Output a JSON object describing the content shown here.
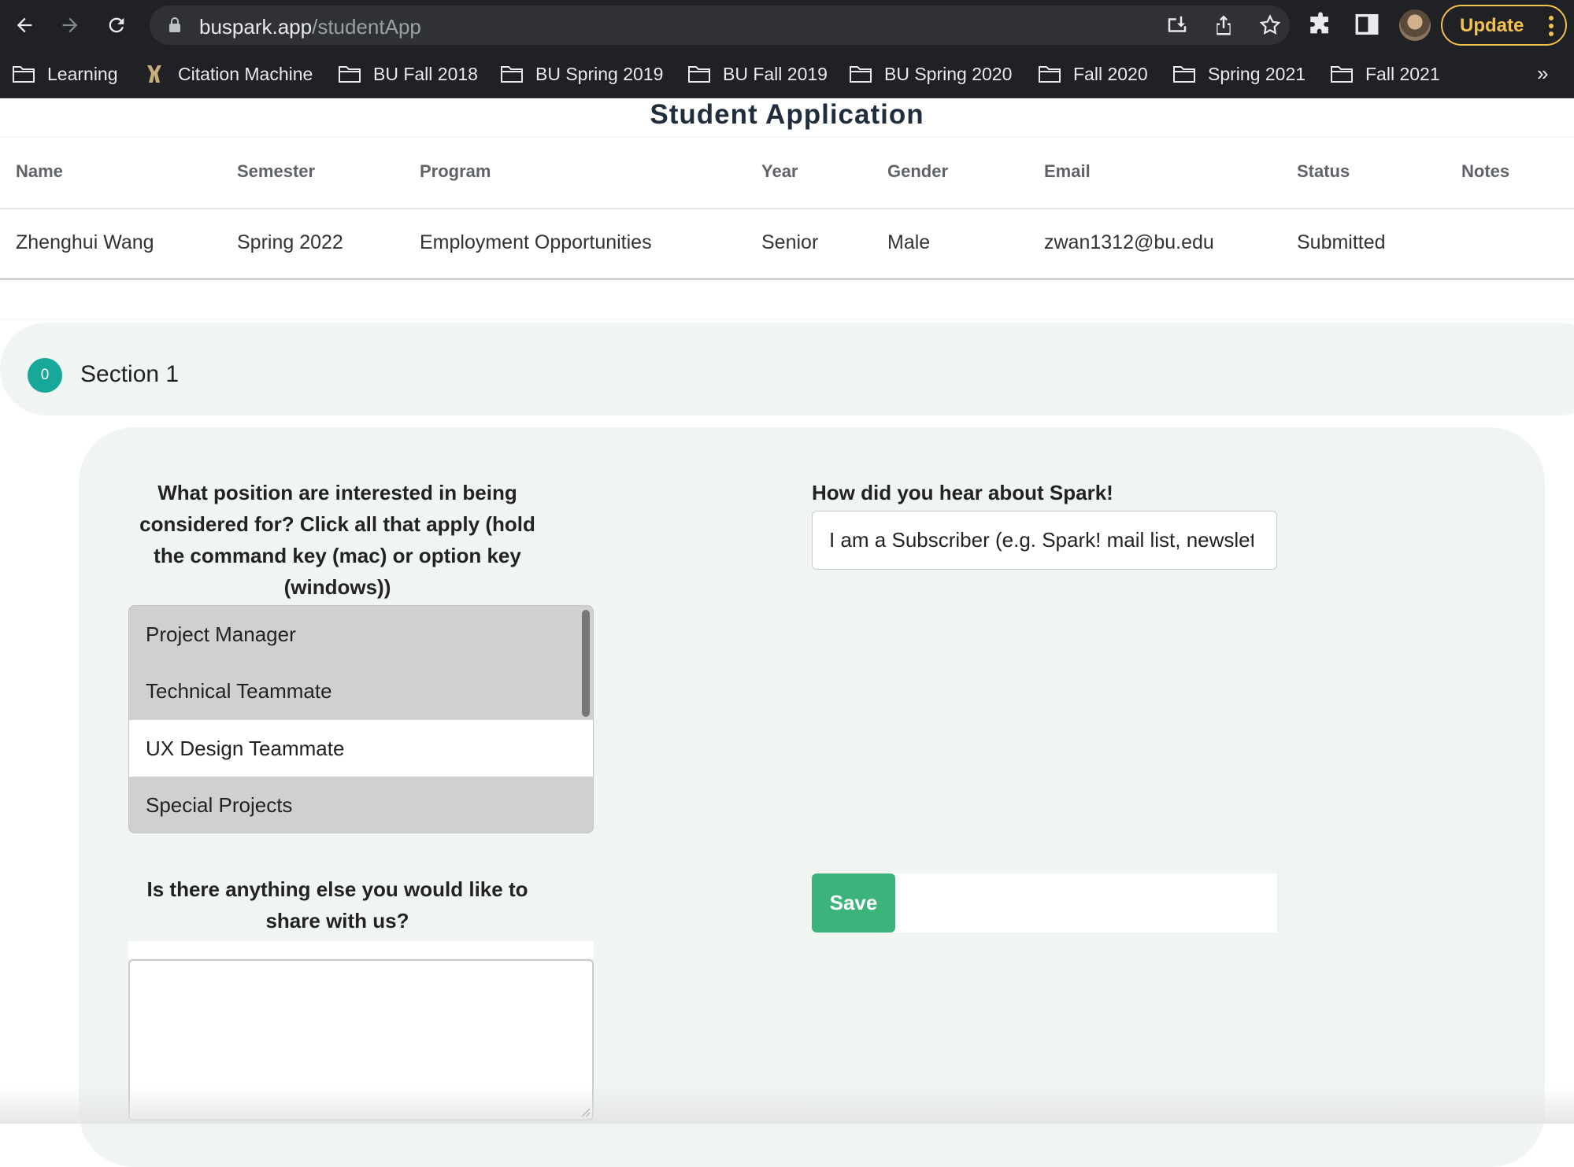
{
  "browser": {
    "url_host": "buspark.app",
    "url_path": "/studentApp",
    "update_label": "Update",
    "bookmarks": [
      "Learning",
      "Citation Machine",
      "BU Fall 2018",
      "BU Spring 2019",
      "BU Fall 2019",
      "BU Spring 2020",
      "Fall 2020",
      "Spring 2021",
      "Fall 2021"
    ],
    "more_label": "»"
  },
  "page": {
    "title": "Student Application"
  },
  "table": {
    "headers": [
      "Name",
      "Semester",
      "Program",
      "Year",
      "Gender",
      "Email",
      "Status",
      "Notes"
    ],
    "row": [
      "Zhenghui Wang",
      "Spring 2022",
      "Employment Opportunities",
      "Senior",
      "Male",
      "zwan1312@bu.edu",
      "Submitted",
      ""
    ]
  },
  "section": {
    "badge": "0",
    "title": "Section 1"
  },
  "form": {
    "position_question": "What position are interested in being considered for? Click all that apply (hold the command key (mac) or option key (windows))",
    "position_options": [
      "Project Manager",
      "Technical Teammate",
      "UX Design Teammate",
      "Special Projects"
    ],
    "hear_question": "How did you hear about Spark!",
    "hear_value": "I am a Subscriber (e.g. Spark! mail list, newsletter)",
    "else_question": "Is there anything else you would like to share with us?",
    "else_value": "",
    "save_label": "Save"
  },
  "colors": {
    "accent_teal": "#17a89a",
    "save_green": "#3cb37a",
    "card_bg": "#f0f5f2",
    "update_yellow": "#f2c14e"
  }
}
